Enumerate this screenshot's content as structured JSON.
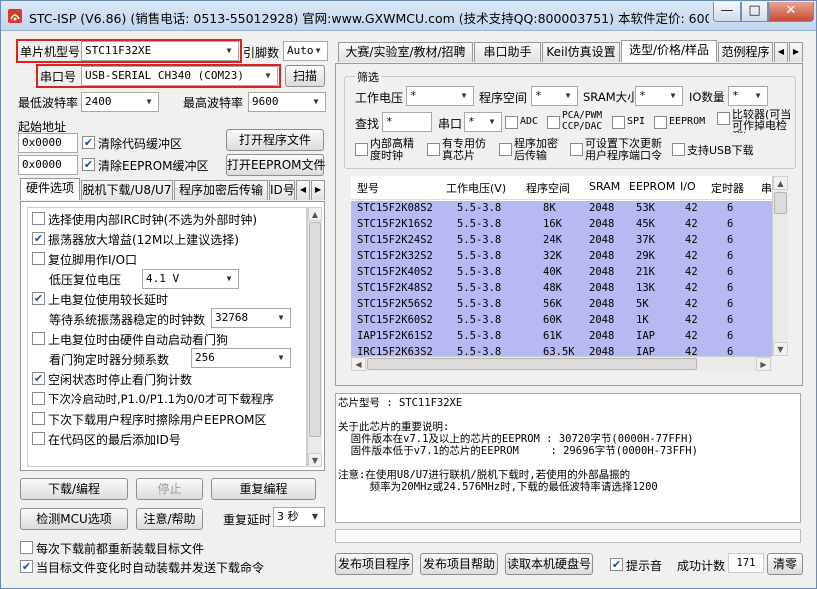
{
  "window": {
    "title": "STC-ISP (V6.86) (销售电话: 0513-55012928) 官网:www.GXWMCU.com  (技术支持QQ:800003751) 本软件定价: 6000元(..."
  },
  "left": {
    "mcu_label": "单片机型号",
    "mcu_value": "STC11F32XE",
    "pin_label": "引脚数",
    "pin_value": "Auto",
    "port_label": "串口号",
    "port_value": "USB-SERIAL CH340 (COM23)",
    "scan_label": "扫描",
    "min_baud_label": "最低波特率",
    "min_baud_value": "2400",
    "max_baud_label": "最高波特率",
    "max_baud_value": "9600",
    "start_addr_label": "起始地址",
    "addr1": "0x0000",
    "clear_code_label": "清除代码缓冲区",
    "open_prog_label": "打开程序文件",
    "addr2": "0x0000",
    "clear_eeprom_label": "清除EEPROM缓冲区",
    "open_eeprom_label": "打开EEPROM文件",
    "tabs": [
      "硬件选项",
      "脱机下载/U8/U7",
      "程序加密后传输",
      "ID号"
    ],
    "options": [
      {
        "label": "选择使用内部IRC时钟(不选为外部时钟)",
        "checked": false
      },
      {
        "label": "振荡器放大增益(12M以上建议选择)",
        "checked": true
      },
      {
        "label": "复位脚用作I/O口",
        "checked": false
      },
      {
        "label": "上电复位使用较长延时",
        "checked": true
      },
      {
        "label": "上电复位时由硬件自动启动看门狗",
        "checked": false
      },
      {
        "label": "空闲状态时停止看门狗计数",
        "checked": true
      },
      {
        "label": "下次冷启动时,P1.0/P1.1为0/0才可下载程序",
        "checked": false
      },
      {
        "label": "下次下载用户程序时擦除用户EEPROM区",
        "checked": false
      },
      {
        "label": "在代码区的最后添加ID号",
        "checked": false
      }
    ],
    "lvr_label": "低压复位电压",
    "lvr_value": "4.1 V",
    "wait_label": "等待系统振荡器稳定的时钟数",
    "wait_value": "32768",
    "wdt_label": "看门狗定时器分频系数",
    "wdt_value": "256",
    "download_label": "下载/编程",
    "stop_label": "停止",
    "reprogram_label": "重复编程",
    "detect_label": "检测MCU选项",
    "help_label": "注意/帮助",
    "delay_label": "重复延时",
    "delay_value": "3 秒",
    "reload_label": "每次下载前都重新装载目标文件",
    "auto_load_label": "当目标文件变化时自动装载并发送下载命令"
  },
  "right": {
    "tabs": [
      "大赛/实验室/教材/招聘",
      "串口助手",
      "Keil仿真设置",
      "选型/价格/样品",
      "范例程序"
    ],
    "filter_label": "筛选",
    "voltage_label": "工作电压",
    "prog_space_label": "程序空间",
    "sram_label": "SRAM大小",
    "io_label": "IO数量",
    "any": "*",
    "compare_label": "比较器(可当可作掉电检测)",
    "find_label": "查找",
    "find_value": "*",
    "uart_label": "串口",
    "adc_label": "ADC",
    "pca_label": "PCA/PWM CCP/DAC",
    "spi_label": "SPI",
    "eeprom_label": "EEPROM",
    "irc_label": "内部高精度时钟",
    "sim_label": "有专用仿真芯片",
    "enc_label": "程序加密后传输",
    "port_cfg_label": "可设置下次更新用户程序端口令",
    "usb_label": "支持USB下载",
    "columns": [
      "型号",
      "工作电压(V)",
      "程序空间",
      "SRAM",
      "EEPROM",
      "I/O",
      "定时器",
      "串"
    ],
    "rows": [
      [
        "STC15F2K08S2",
        "5.5-3.8",
        "8K",
        "2048",
        "53K",
        "42",
        "6"
      ],
      [
        "STC15F2K16S2",
        "5.5-3.8",
        "16K",
        "2048",
        "45K",
        "42",
        "6"
      ],
      [
        "STC15F2K24S2",
        "5.5-3.8",
        "24K",
        "2048",
        "37K",
        "42",
        "6"
      ],
      [
        "STC15F2K32S2",
        "5.5-3.8",
        "32K",
        "2048",
        "29K",
        "42",
        "6"
      ],
      [
        "STC15F2K40S2",
        "5.5-3.8",
        "40K",
        "2048",
        "21K",
        "42",
        "6"
      ],
      [
        "STC15F2K48S2",
        "5.5-3.8",
        "48K",
        "2048",
        "13K",
        "42",
        "6"
      ],
      [
        "STC15F2K56S2",
        "5.5-3.8",
        "56K",
        "2048",
        "5K",
        "42",
        "6"
      ],
      [
        "STC15F2K60S2",
        "5.5-3.8",
        "60K",
        "2048",
        "1K",
        "42",
        "6"
      ],
      [
        "IAP15F2K61S2",
        "5.5-3.8",
        "61K",
        "2048",
        "IAP",
        "42",
        "6"
      ],
      [
        "IRC15F2K63S2",
        "5.5-3.8",
        "63.5K",
        "2048",
        "IAP",
        "42",
        "6"
      ]
    ],
    "info_lines": [
      "芯片型号 : STC11F32XE",
      "",
      "关于此芯片的重要说明:",
      "  固件版本在v7.1及以上的芯片的EEPROM : 30720字节(0000H-77FFH)",
      "  固件版本低于v7.1的芯片的EEPROM     : 29696字节(0000H-73FFH)",
      "",
      "注意:在使用U8/U7进行联机/脱机下载时,若使用的外部晶振的",
      "     频率为20MHz或24.576MHz时,下载的最低波特率请选择1200"
    ],
    "publish_label": "发布项目程序",
    "publish_help_label": "发布项目帮助",
    "read_disk_label": "读取本机硬盘号",
    "sound_label": "提示音",
    "count_label": "成功计数",
    "count_value": "171",
    "clear_label": "清零"
  }
}
